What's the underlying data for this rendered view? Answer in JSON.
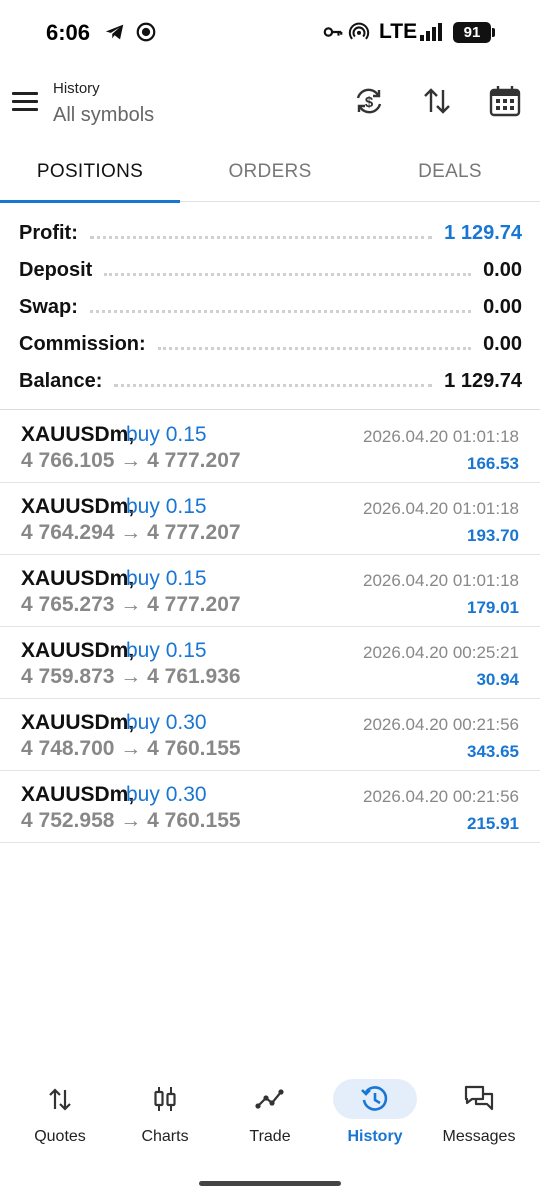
{
  "status_bar": {
    "time": "6:06",
    "network": "LTE",
    "battery": "91"
  },
  "header": {
    "title": "History",
    "subtitle": "All symbols"
  },
  "tabs": [
    {
      "label": "POSITIONS",
      "active": true
    },
    {
      "label": "ORDERS",
      "active": false
    },
    {
      "label": "DEALS",
      "active": false
    }
  ],
  "summary": {
    "profit": {
      "label": "Profit:",
      "value": "1 129.74"
    },
    "deposit": {
      "label": "Deposit",
      "value": "0.00"
    },
    "swap": {
      "label": "Swap:",
      "value": "0.00"
    },
    "commission": {
      "label": "Commission:",
      "value": "0.00"
    },
    "balance": {
      "label": "Balance:",
      "value": "1 129.74"
    }
  },
  "deals": [
    {
      "symbol": "XAUUSDm,",
      "type": "buy 0.15",
      "time": "2026.04.20 01:01:18",
      "open": "4 766.105",
      "close": "4 777.207",
      "profit": "166.53"
    },
    {
      "symbol": "XAUUSDm,",
      "type": "buy 0.15",
      "time": "2026.04.20 01:01:18",
      "open": "4 764.294",
      "close": "4 777.207",
      "profit": "193.70"
    },
    {
      "symbol": "XAUUSDm,",
      "type": "buy 0.15",
      "time": "2026.04.20 01:01:18",
      "open": "4 765.273",
      "close": "4 777.207",
      "profit": "179.01"
    },
    {
      "symbol": "XAUUSDm,",
      "type": "buy 0.15",
      "time": "2026.04.20 00:25:21",
      "open": "4 759.873",
      "close": "4 761.936",
      "profit": "30.94"
    },
    {
      "symbol": "XAUUSDm,",
      "type": "buy 0.30",
      "time": "2026.04.20 00:21:56",
      "open": "4 748.700",
      "close": "4 760.155",
      "profit": "343.65"
    },
    {
      "symbol": "XAUUSDm,",
      "type": "buy 0.30",
      "time": "2026.04.20 00:21:56",
      "open": "4 752.958",
      "close": "4 760.155",
      "profit": "215.91"
    }
  ],
  "arrow": "→",
  "nav": [
    {
      "label": "Quotes",
      "icon": "quotes-icon",
      "active": false
    },
    {
      "label": "Charts",
      "icon": "charts-icon",
      "active": false
    },
    {
      "label": "Trade",
      "icon": "trade-icon",
      "active": false
    },
    {
      "label": "History",
      "icon": "history-icon",
      "active": true
    },
    {
      "label": "Messages",
      "icon": "messages-icon",
      "active": false
    }
  ],
  "colors": {
    "accent": "#1976d2",
    "muted_text": "#888888",
    "active_nav_bg": "#e4eefb"
  }
}
